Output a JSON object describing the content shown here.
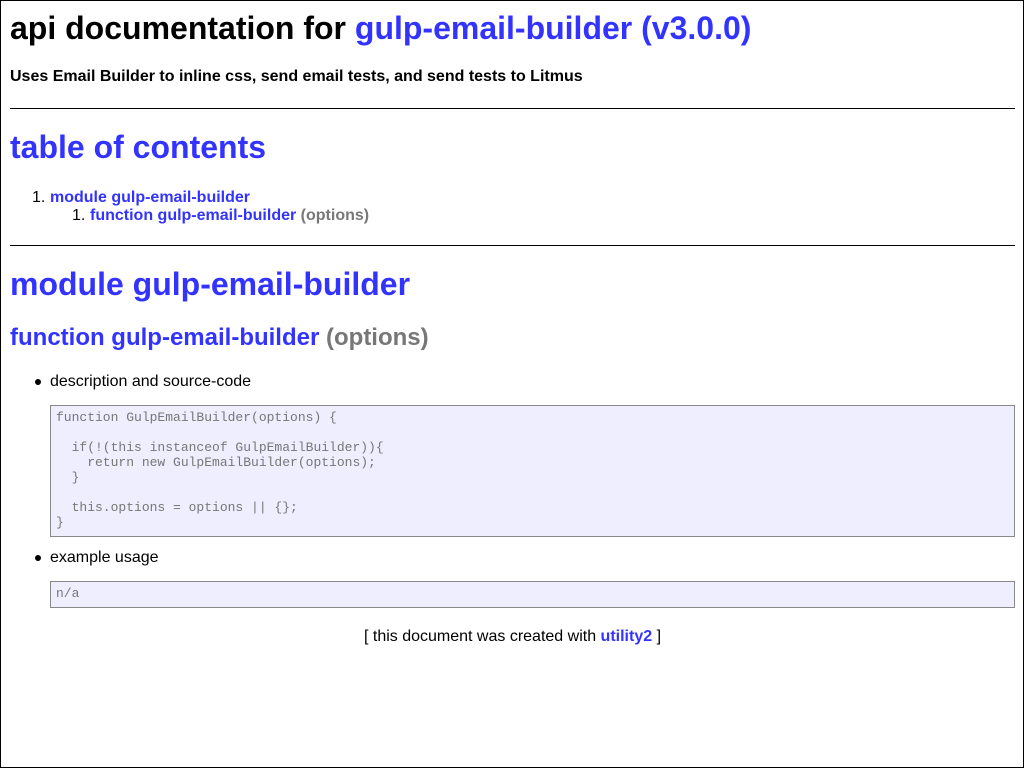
{
  "header": {
    "title_prefix": "api documentation for",
    "package_link": "gulp-email-builder (v3.0.0)",
    "description": "Uses Email Builder to inline css, send email tests, and send tests to Litmus"
  },
  "toc": {
    "heading": "table of contents",
    "items": [
      {
        "number": "1.",
        "label": "module gulp-email-builder",
        "children": [
          {
            "number": "1.",
            "label": "function gulp-email-builder",
            "params": "(options)"
          }
        ]
      }
    ]
  },
  "module": {
    "heading": "module gulp-email-builder",
    "function": {
      "name": "function gulp-email-builder",
      "params": "(options)",
      "description_label": "description and source-code",
      "source_code": "function GulpEmailBuilder(options) {\n\n  if(!(this instanceof GulpEmailBuilder)){\n    return new GulpEmailBuilder(options);\n  }\n\n  this.options = options || {};\n}",
      "example_label": "example usage",
      "example_code": "n/a"
    }
  },
  "footer": {
    "prefix": "[ this document was created with",
    "link": "utility2",
    "suffix": "]"
  }
}
